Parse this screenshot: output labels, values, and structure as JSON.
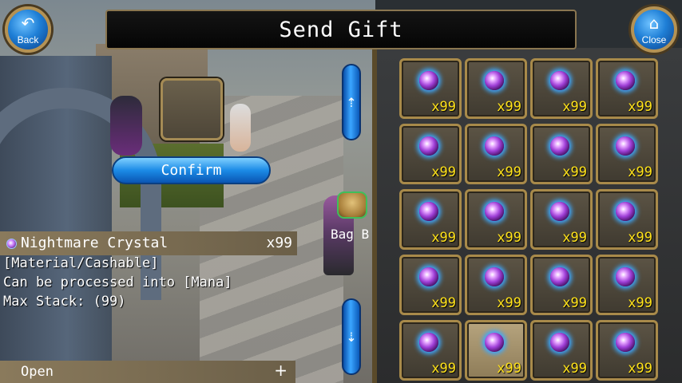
{
  "header": {
    "title": "Send Gift",
    "back_label": "Back",
    "close_label": "Close"
  },
  "left_panel": {
    "confirm_label": "Confirm",
    "bag_label": "Bag B",
    "scroll_up_icon": "arrow-up",
    "scroll_down_icon": "arrow-down"
  },
  "item_info": {
    "name": "Nightmare Crystal",
    "count": "x99",
    "lines": [
      "[Material/Cashable]",
      "Can be processed into [Mana]",
      "Max Stack: (99)"
    ],
    "open_label": "Open",
    "open_icon": "+"
  },
  "inventory": {
    "columns": 4,
    "selected_index": 17,
    "slots": [
      {
        "item": "Nightmare Crystal",
        "qty": "x99"
      },
      {
        "item": "Nightmare Crystal",
        "qty": "x99"
      },
      {
        "item": "Nightmare Crystal",
        "qty": "x99"
      },
      {
        "item": "Nightmare Crystal",
        "qty": "x99"
      },
      {
        "item": "Nightmare Crystal",
        "qty": "x99"
      },
      {
        "item": "Nightmare Crystal",
        "qty": "x99"
      },
      {
        "item": "Nightmare Crystal",
        "qty": "x99"
      },
      {
        "item": "Nightmare Crystal",
        "qty": "x99"
      },
      {
        "item": "Nightmare Crystal",
        "qty": "x99"
      },
      {
        "item": "Nightmare Crystal",
        "qty": "x99"
      },
      {
        "item": "Nightmare Crystal",
        "qty": "x99"
      },
      {
        "item": "Nightmare Crystal",
        "qty": "x99"
      },
      {
        "item": "Nightmare Crystal",
        "qty": "x99"
      },
      {
        "item": "Nightmare Crystal",
        "qty": "x99"
      },
      {
        "item": "Nightmare Crystal",
        "qty": "x99"
      },
      {
        "item": "Nightmare Crystal",
        "qty": "x99"
      },
      {
        "item": "Nightmare Crystal",
        "qty": "x99"
      },
      {
        "item": "Nightmare Crystal",
        "qty": "x99"
      },
      {
        "item": "Nightmare Crystal",
        "qty": "x99"
      },
      {
        "item": "Nightmare Crystal",
        "qty": "x99"
      }
    ]
  },
  "colors": {
    "quantity_text": "#ffe21a",
    "button_blue": "#1b8be6",
    "frame_gold": "#a88a4a"
  }
}
